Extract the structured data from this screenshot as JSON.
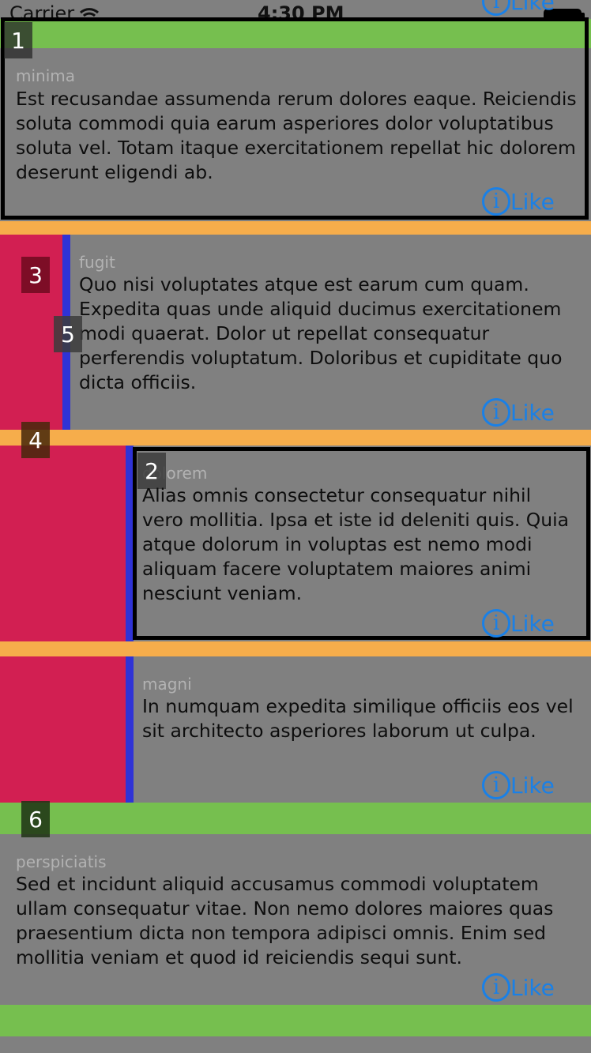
{
  "status_bar": {
    "carrier": "Carrier",
    "time": "4:30 PM"
  },
  "like_label": "Like",
  "info_glyph": "i",
  "top_partial_like": "Like",
  "debug_tags": [
    "1",
    "2",
    "3",
    "4",
    "5",
    "6"
  ],
  "cells": [
    {
      "title": "minima",
      "body": "Est recusandae assumenda rerum dolores eaque. Reiciendis soluta commodi quia earum asperiores dolor voluptatibus soluta vel. Totam itaque exercitationem repellat hic dolorem deserunt eligendi ab."
    },
    {
      "title": "fugit",
      "body": "Quo nisi voluptates atque est earum cum quam. Expedita quas unde aliquid ducimus exercitationem modi quaerat. Dolor ut repellat consequatur perferendis voluptatum. Doloribus et cupiditate quo dicta officiis."
    },
    {
      "title": "dolorem",
      "body": "Alias omnis consectetur consequatur nihil vero mollitia. Ipsa et iste id deleniti quis. Quia atque dolorum in voluptas est nemo modi aliquam facere voluptatem maiores animi nesciunt veniam."
    },
    {
      "title": "magni",
      "body": "In numquam expedita similique officiis eos vel sit architecto asperiores laborum ut culpa."
    },
    {
      "title": "perspiciatis",
      "body": "Sed et incidunt aliquid accusamus commodi voluptatem ullam consequatur vitae. Non nemo dolores maiores quas praesentium dicta non tempora adipisci omnis. Enim sed mollitia veniam et quod id reiciendis sequi sunt."
    }
  ],
  "colors": {
    "background": "#808080",
    "green": "#76bf4f",
    "orange": "#f6ad4b",
    "crimson": "#d21f52",
    "blue": "#2f33d6",
    "like": "#1a80e6"
  }
}
